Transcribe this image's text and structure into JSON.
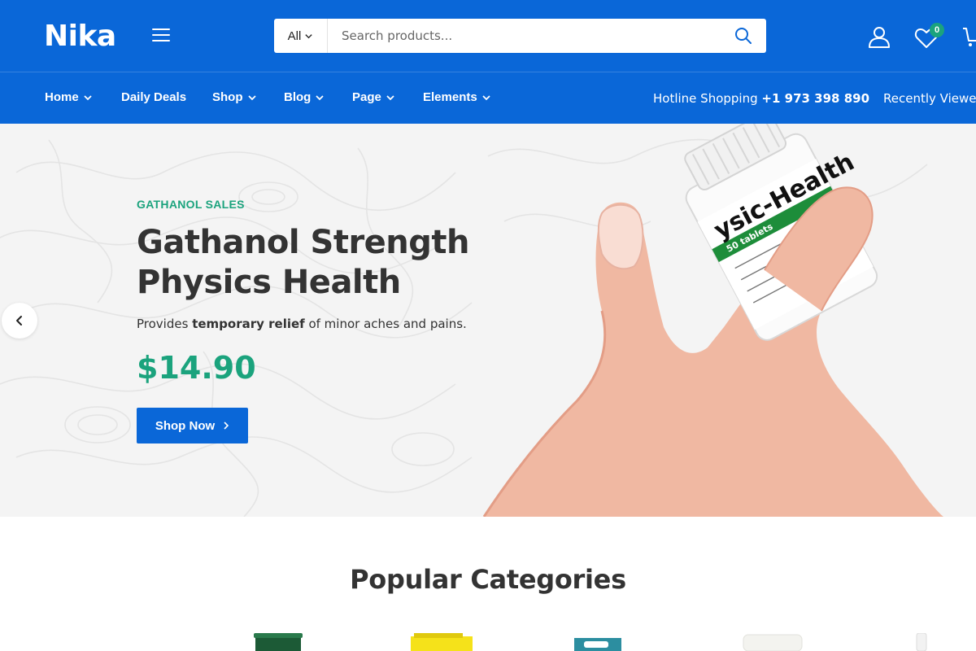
{
  "header": {
    "logo": "Nika",
    "search": {
      "category_label": "All",
      "placeholder": "Search products..."
    },
    "wishlist_count": "0"
  },
  "nav": {
    "items": [
      {
        "label": "Home",
        "has_dropdown": true
      },
      {
        "label": "Daily Deals",
        "has_dropdown": false
      },
      {
        "label": "Shop",
        "has_dropdown": true
      },
      {
        "label": "Blog",
        "has_dropdown": true
      },
      {
        "label": "Page",
        "has_dropdown": true
      },
      {
        "label": "Elements",
        "has_dropdown": true
      }
    ],
    "hotline_label": "Hotline Shopping",
    "hotline_number": "+1 973 398 890",
    "recently_viewed": "Recently Viewed"
  },
  "hero": {
    "kicker": "GATHANOL SALES",
    "title_line1": "Gathanol Strength",
    "title_line2": "Physics Health",
    "desc_before": "Provides ",
    "desc_bold": "temporary relief",
    "desc_after": " of minor aches and pains.",
    "price": "$14.90",
    "button_label": "Shop Now",
    "bottle_label_main": "ysic-Health",
    "bottle_label_sub": "50 tablets"
  },
  "categories": {
    "title": "Popular Categories"
  },
  "colors": {
    "brand_blue": "#0a67d8",
    "accent_green": "#1ba37d",
    "hero_bg": "#f4f4f4"
  }
}
